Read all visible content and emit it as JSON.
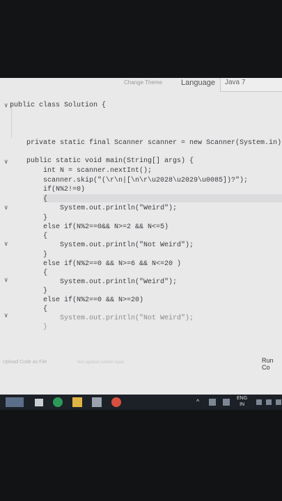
{
  "topbar": {
    "theme_label": "Change Theme",
    "language_label": "Language",
    "language_value": "Java 7"
  },
  "editor": {
    "lines": [
      "public class Solution {",
      "",
      "",
      "",
      "    private static final Scanner scanner = new Scanner(System.in);",
      "",
      "    public static void main(String[] args) {",
      "        int N = scanner.nextInt();",
      "        scanner.skip(\"(\\r\\n|[\\n\\r\\u2028\\u2029\\u0085])?\");",
      "        if(N%2!=0)",
      "        {",
      "            System.out.println(\"Weird\");",
      "        }",
      "        else if(N%2==0&& N>=2 && N<=5)",
      "        {",
      "            System.out.println(\"Not Weird\");",
      "        }",
      "        else if(N%2==0 && N>=6 && N<=20 )",
      "        {",
      "            System.out.println(\"Weird\");",
      "        }",
      "        else if(N%2==0 && N>=20)",
      "        {",
      "            System.out.println(\"Not Weird\");",
      "        }"
    ],
    "fold_marker": "∨"
  },
  "footer": {
    "upload_label": "Upload Code as File",
    "hint": "Test against custom input",
    "run_label": "Run Co"
  },
  "taskbar": {
    "lang_top": "ENG",
    "lang_bottom": "IN",
    "chevron": "^"
  }
}
